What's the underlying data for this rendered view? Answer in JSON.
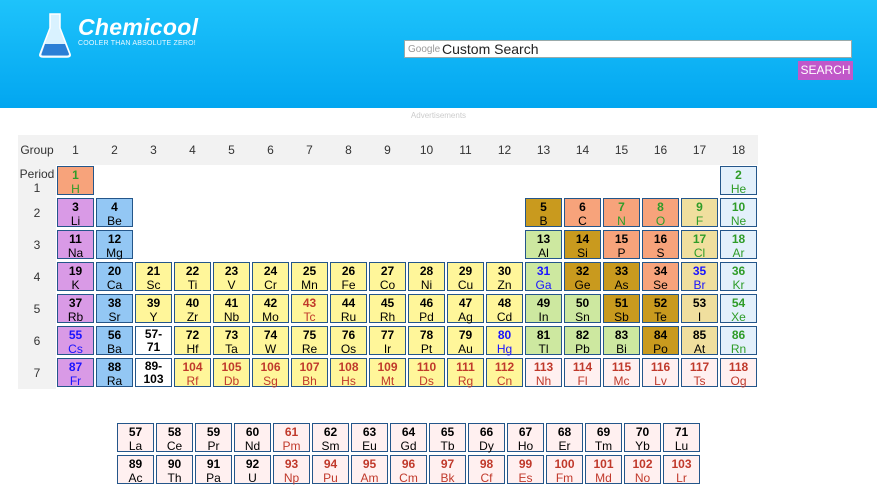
{
  "site": {
    "title": "Chemicool",
    "tagline": "COOLER THAN ABSOLUTE ZERO!"
  },
  "search": {
    "google_label": "Google",
    "value": "Custom Search",
    "button": "SEARCH"
  },
  "ads_label": "Advertisements",
  "table": {
    "group_label": "Group",
    "period_label": "Period",
    "groups": [
      "1",
      "2",
      "3",
      "4",
      "5",
      "6",
      "7",
      "8",
      "9",
      "10",
      "11",
      "12",
      "13",
      "14",
      "15",
      "16",
      "17",
      "18"
    ],
    "periods": [
      "1",
      "2",
      "3",
      "4",
      "5",
      "6",
      "7"
    ],
    "colors": {
      "alkali": "#d99ae6",
      "alkaline": "#93c7f4",
      "transition": "#fff69a",
      "posttransition": "#cde8a0",
      "metalloid": "#c99a1e",
      "nonmetal": "#f7a37b",
      "halogen": "#f0df9e",
      "noble": "#e3f0fb",
      "lanact": "#fff0f0",
      "placeholder": "#ffffff"
    },
    "text_colors": {
      "solid": "#000000",
      "liquid": "#1a14ff",
      "gas": "#2e9c28",
      "synthetic": "#c0392b"
    },
    "elements": [
      {
        "n": "1",
        "s": "H",
        "r": 1,
        "c": 1,
        "cat": "nonmetal",
        "st": "gas"
      },
      {
        "n": "2",
        "s": "He",
        "r": 1,
        "c": 18,
        "cat": "noble",
        "st": "gas"
      },
      {
        "n": "3",
        "s": "Li",
        "r": 2,
        "c": 1,
        "cat": "alkali",
        "st": "solid"
      },
      {
        "n": "4",
        "s": "Be",
        "r": 2,
        "c": 2,
        "cat": "alkaline",
        "st": "solid"
      },
      {
        "n": "5",
        "s": "B",
        "r": 2,
        "c": 13,
        "cat": "metalloid",
        "st": "solid"
      },
      {
        "n": "6",
        "s": "C",
        "r": 2,
        "c": 14,
        "cat": "nonmetal",
        "st": "solid"
      },
      {
        "n": "7",
        "s": "N",
        "r": 2,
        "c": 15,
        "cat": "nonmetal",
        "st": "gas"
      },
      {
        "n": "8",
        "s": "O",
        "r": 2,
        "c": 16,
        "cat": "nonmetal",
        "st": "gas"
      },
      {
        "n": "9",
        "s": "F",
        "r": 2,
        "c": 17,
        "cat": "halogen",
        "st": "gas"
      },
      {
        "n": "10",
        "s": "Ne",
        "r": 2,
        "c": 18,
        "cat": "noble",
        "st": "gas"
      },
      {
        "n": "11",
        "s": "Na",
        "r": 3,
        "c": 1,
        "cat": "alkali",
        "st": "solid"
      },
      {
        "n": "12",
        "s": "Mg",
        "r": 3,
        "c": 2,
        "cat": "alkaline",
        "st": "solid"
      },
      {
        "n": "13",
        "s": "Al",
        "r": 3,
        "c": 13,
        "cat": "posttransition",
        "st": "solid"
      },
      {
        "n": "14",
        "s": "Si",
        "r": 3,
        "c": 14,
        "cat": "metalloid",
        "st": "solid"
      },
      {
        "n": "15",
        "s": "P",
        "r": 3,
        "c": 15,
        "cat": "nonmetal",
        "st": "solid"
      },
      {
        "n": "16",
        "s": "S",
        "r": 3,
        "c": 16,
        "cat": "nonmetal",
        "st": "solid"
      },
      {
        "n": "17",
        "s": "Cl",
        "r": 3,
        "c": 17,
        "cat": "halogen",
        "st": "gas"
      },
      {
        "n": "18",
        "s": "Ar",
        "r": 3,
        "c": 18,
        "cat": "noble",
        "st": "gas"
      },
      {
        "n": "19",
        "s": "K",
        "r": 4,
        "c": 1,
        "cat": "alkali",
        "st": "solid"
      },
      {
        "n": "20",
        "s": "Ca",
        "r": 4,
        "c": 2,
        "cat": "alkaline",
        "st": "solid"
      },
      {
        "n": "21",
        "s": "Sc",
        "r": 4,
        "c": 3,
        "cat": "transition",
        "st": "solid"
      },
      {
        "n": "22",
        "s": "Ti",
        "r": 4,
        "c": 4,
        "cat": "transition",
        "st": "solid"
      },
      {
        "n": "23",
        "s": "V",
        "r": 4,
        "c": 5,
        "cat": "transition",
        "st": "solid"
      },
      {
        "n": "24",
        "s": "Cr",
        "r": 4,
        "c": 6,
        "cat": "transition",
        "st": "solid"
      },
      {
        "n": "25",
        "s": "Mn",
        "r": 4,
        "c": 7,
        "cat": "transition",
        "st": "solid"
      },
      {
        "n": "26",
        "s": "Fe",
        "r": 4,
        "c": 8,
        "cat": "transition",
        "st": "solid"
      },
      {
        "n": "27",
        "s": "Co",
        "r": 4,
        "c": 9,
        "cat": "transition",
        "st": "solid"
      },
      {
        "n": "28",
        "s": "Ni",
        "r": 4,
        "c": 10,
        "cat": "transition",
        "st": "solid"
      },
      {
        "n": "29",
        "s": "Cu",
        "r": 4,
        "c": 11,
        "cat": "transition",
        "st": "solid"
      },
      {
        "n": "30",
        "s": "Zn",
        "r": 4,
        "c": 12,
        "cat": "transition",
        "st": "solid"
      },
      {
        "n": "31",
        "s": "Ga",
        "r": 4,
        "c": 13,
        "cat": "posttransition",
        "st": "liquid"
      },
      {
        "n": "32",
        "s": "Ge",
        "r": 4,
        "c": 14,
        "cat": "metalloid",
        "st": "solid"
      },
      {
        "n": "33",
        "s": "As",
        "r": 4,
        "c": 15,
        "cat": "metalloid",
        "st": "solid"
      },
      {
        "n": "34",
        "s": "Se",
        "r": 4,
        "c": 16,
        "cat": "nonmetal",
        "st": "solid"
      },
      {
        "n": "35",
        "s": "Br",
        "r": 4,
        "c": 17,
        "cat": "halogen",
        "st": "liquid"
      },
      {
        "n": "36",
        "s": "Kr",
        "r": 4,
        "c": 18,
        "cat": "noble",
        "st": "gas"
      },
      {
        "n": "37",
        "s": "Rb",
        "r": 5,
        "c": 1,
        "cat": "alkali",
        "st": "solid"
      },
      {
        "n": "38",
        "s": "Sr",
        "r": 5,
        "c": 2,
        "cat": "alkaline",
        "st": "solid"
      },
      {
        "n": "39",
        "s": "Y",
        "r": 5,
        "c": 3,
        "cat": "transition",
        "st": "solid"
      },
      {
        "n": "40",
        "s": "Zr",
        "r": 5,
        "c": 4,
        "cat": "transition",
        "st": "solid"
      },
      {
        "n": "41",
        "s": "Nb",
        "r": 5,
        "c": 5,
        "cat": "transition",
        "st": "solid"
      },
      {
        "n": "42",
        "s": "Mo",
        "r": 5,
        "c": 6,
        "cat": "transition",
        "st": "solid"
      },
      {
        "n": "43",
        "s": "Tc",
        "r": 5,
        "c": 7,
        "cat": "transition",
        "st": "synthetic"
      },
      {
        "n": "44",
        "s": "Ru",
        "r": 5,
        "c": 8,
        "cat": "transition",
        "st": "solid"
      },
      {
        "n": "45",
        "s": "Rh",
        "r": 5,
        "c": 9,
        "cat": "transition",
        "st": "solid"
      },
      {
        "n": "46",
        "s": "Pd",
        "r": 5,
        "c": 10,
        "cat": "transition",
        "st": "solid"
      },
      {
        "n": "47",
        "s": "Ag",
        "r": 5,
        "c": 11,
        "cat": "transition",
        "st": "solid"
      },
      {
        "n": "48",
        "s": "Cd",
        "r": 5,
        "c": 12,
        "cat": "transition",
        "st": "solid"
      },
      {
        "n": "49",
        "s": "In",
        "r": 5,
        "c": 13,
        "cat": "posttransition",
        "st": "solid"
      },
      {
        "n": "50",
        "s": "Sn",
        "r": 5,
        "c": 14,
        "cat": "posttransition",
        "st": "solid"
      },
      {
        "n": "51",
        "s": "Sb",
        "r": 5,
        "c": 15,
        "cat": "metalloid",
        "st": "solid"
      },
      {
        "n": "52",
        "s": "Te",
        "r": 5,
        "c": 16,
        "cat": "metalloid",
        "st": "solid"
      },
      {
        "n": "53",
        "s": "I",
        "r": 5,
        "c": 17,
        "cat": "halogen",
        "st": "solid"
      },
      {
        "n": "54",
        "s": "Xe",
        "r": 5,
        "c": 18,
        "cat": "noble",
        "st": "gas"
      },
      {
        "n": "55",
        "s": "Cs",
        "r": 6,
        "c": 1,
        "cat": "alkali",
        "st": "liquid"
      },
      {
        "n": "56",
        "s": "Ba",
        "r": 6,
        "c": 2,
        "cat": "alkaline",
        "st": "solid"
      },
      {
        "n": "57-\n71",
        "s": "",
        "r": 6,
        "c": 3,
        "cat": "placeholder",
        "st": "solid"
      },
      {
        "n": "72",
        "s": "Hf",
        "r": 6,
        "c": 4,
        "cat": "transition",
        "st": "solid"
      },
      {
        "n": "73",
        "s": "Ta",
        "r": 6,
        "c": 5,
        "cat": "transition",
        "st": "solid"
      },
      {
        "n": "74",
        "s": "W",
        "r": 6,
        "c": 6,
        "cat": "transition",
        "st": "solid"
      },
      {
        "n": "75",
        "s": "Re",
        "r": 6,
        "c": 7,
        "cat": "transition",
        "st": "solid"
      },
      {
        "n": "76",
        "s": "Os",
        "r": 6,
        "c": 8,
        "cat": "transition",
        "st": "solid"
      },
      {
        "n": "77",
        "s": "Ir",
        "r": 6,
        "c": 9,
        "cat": "transition",
        "st": "solid"
      },
      {
        "n": "78",
        "s": "Pt",
        "r": 6,
        "c": 10,
        "cat": "transition",
        "st": "solid"
      },
      {
        "n": "79",
        "s": "Au",
        "r": 6,
        "c": 11,
        "cat": "transition",
        "st": "solid"
      },
      {
        "n": "80",
        "s": "Hg",
        "r": 6,
        "c": 12,
        "cat": "transition",
        "st": "liquid"
      },
      {
        "n": "81",
        "s": "Tl",
        "r": 6,
        "c": 13,
        "cat": "posttransition",
        "st": "solid"
      },
      {
        "n": "82",
        "s": "Pb",
        "r": 6,
        "c": 14,
        "cat": "posttransition",
        "st": "solid"
      },
      {
        "n": "83",
        "s": "Bi",
        "r": 6,
        "c": 15,
        "cat": "posttransition",
        "st": "solid"
      },
      {
        "n": "84",
        "s": "Po",
        "r": 6,
        "c": 16,
        "cat": "metalloid",
        "st": "solid"
      },
      {
        "n": "85",
        "s": "At",
        "r": 6,
        "c": 17,
        "cat": "halogen",
        "st": "solid"
      },
      {
        "n": "86",
        "s": "Rn",
        "r": 6,
        "c": 18,
        "cat": "noble",
        "st": "gas"
      },
      {
        "n": "87",
        "s": "Fr",
        "r": 7,
        "c": 1,
        "cat": "alkali",
        "st": "liquid"
      },
      {
        "n": "88",
        "s": "Ra",
        "r": 7,
        "c": 2,
        "cat": "alkaline",
        "st": "solid"
      },
      {
        "n": "89-\n103",
        "s": "",
        "r": 7,
        "c": 3,
        "cat": "placeholder",
        "st": "solid"
      },
      {
        "n": "104",
        "s": "Rf",
        "r": 7,
        "c": 4,
        "cat": "transition",
        "st": "synthetic"
      },
      {
        "n": "105",
        "s": "Db",
        "r": 7,
        "c": 5,
        "cat": "transition",
        "st": "synthetic"
      },
      {
        "n": "106",
        "s": "Sg",
        "r": 7,
        "c": 6,
        "cat": "transition",
        "st": "synthetic"
      },
      {
        "n": "107",
        "s": "Bh",
        "r": 7,
        "c": 7,
        "cat": "transition",
        "st": "synthetic"
      },
      {
        "n": "108",
        "s": "Hs",
        "r": 7,
        "c": 8,
        "cat": "transition",
        "st": "synthetic"
      },
      {
        "n": "109",
        "s": "Mt",
        "r": 7,
        "c": 9,
        "cat": "transition",
        "st": "synthetic"
      },
      {
        "n": "110",
        "s": "Ds",
        "r": 7,
        "c": 10,
        "cat": "transition",
        "st": "synthetic"
      },
      {
        "n": "111",
        "s": "Rg",
        "r": 7,
        "c": 11,
        "cat": "transition",
        "st": "synthetic"
      },
      {
        "n": "112",
        "s": "Cn",
        "r": 7,
        "c": 12,
        "cat": "transition",
        "st": "synthetic"
      },
      {
        "n": "113",
        "s": "Nh",
        "r": 7,
        "c": 13,
        "cat": "lanact",
        "st": "synthetic"
      },
      {
        "n": "114",
        "s": "Fl",
        "r": 7,
        "c": 14,
        "cat": "lanact",
        "st": "synthetic"
      },
      {
        "n": "115",
        "s": "Mc",
        "r": 7,
        "c": 15,
        "cat": "lanact",
        "st": "synthetic"
      },
      {
        "n": "116",
        "s": "Lv",
        "r": 7,
        "c": 16,
        "cat": "lanact",
        "st": "synthetic"
      },
      {
        "n": "117",
        "s": "Ts",
        "r": 7,
        "c": 17,
        "cat": "lanact",
        "st": "synthetic"
      },
      {
        "n": "118",
        "s": "Og",
        "r": 7,
        "c": 18,
        "cat": "lanact",
        "st": "synthetic"
      }
    ],
    "f_block": [
      [
        {
          "n": "57",
          "s": "La",
          "st": "solid"
        },
        {
          "n": "58",
          "s": "Ce",
          "st": "solid"
        },
        {
          "n": "59",
          "s": "Pr",
          "st": "solid"
        },
        {
          "n": "60",
          "s": "Nd",
          "st": "solid"
        },
        {
          "n": "61",
          "s": "Pm",
          "st": "synthetic"
        },
        {
          "n": "62",
          "s": "Sm",
          "st": "solid"
        },
        {
          "n": "63",
          "s": "Eu",
          "st": "solid"
        },
        {
          "n": "64",
          "s": "Gd",
          "st": "solid"
        },
        {
          "n": "65",
          "s": "Tb",
          "st": "solid"
        },
        {
          "n": "66",
          "s": "Dy",
          "st": "solid"
        },
        {
          "n": "67",
          "s": "Ho",
          "st": "solid"
        },
        {
          "n": "68",
          "s": "Er",
          "st": "solid"
        },
        {
          "n": "69",
          "s": "Tm",
          "st": "solid"
        },
        {
          "n": "70",
          "s": "Yb",
          "st": "solid"
        },
        {
          "n": "71",
          "s": "Lu",
          "st": "solid"
        }
      ],
      [
        {
          "n": "89",
          "s": "Ac",
          "st": "solid"
        },
        {
          "n": "90",
          "s": "Th",
          "st": "solid"
        },
        {
          "n": "91",
          "s": "Pa",
          "st": "solid"
        },
        {
          "n": "92",
          "s": "U",
          "st": "solid"
        },
        {
          "n": "93",
          "s": "Np",
          "st": "synthetic"
        },
        {
          "n": "94",
          "s": "Pu",
          "st": "synthetic"
        },
        {
          "n": "95",
          "s": "Am",
          "st": "synthetic"
        },
        {
          "n": "96",
          "s": "Cm",
          "st": "synthetic"
        },
        {
          "n": "97",
          "s": "Bk",
          "st": "synthetic"
        },
        {
          "n": "98",
          "s": "Cf",
          "st": "synthetic"
        },
        {
          "n": "99",
          "s": "Es",
          "st": "synthetic"
        },
        {
          "n": "100",
          "s": "Fm",
          "st": "synthetic"
        },
        {
          "n": "101",
          "s": "Md",
          "st": "synthetic"
        },
        {
          "n": "102",
          "s": "No",
          "st": "synthetic"
        },
        {
          "n": "103",
          "s": "Lr",
          "st": "synthetic"
        }
      ]
    ]
  }
}
